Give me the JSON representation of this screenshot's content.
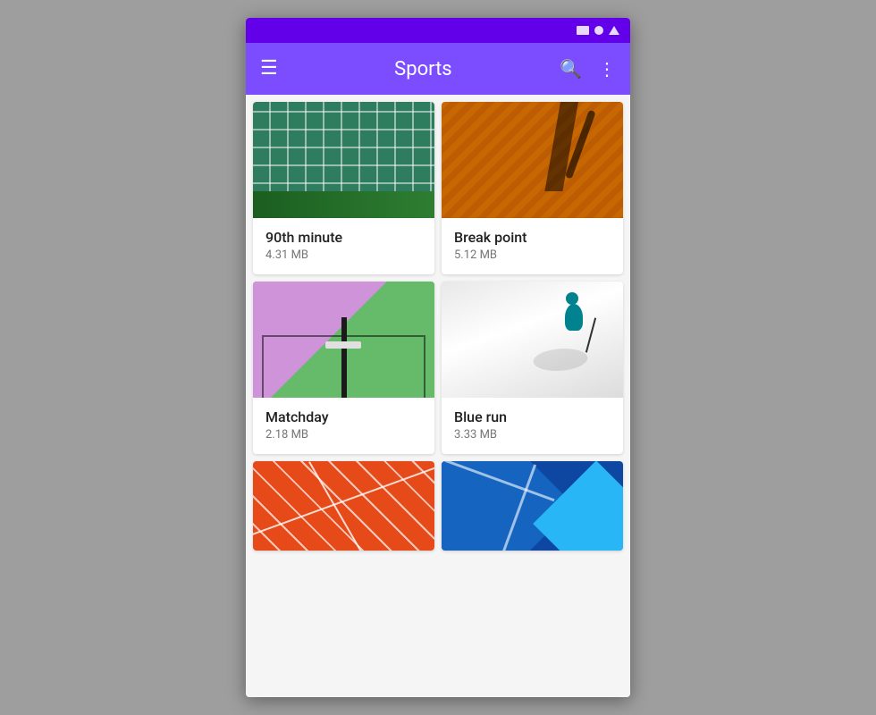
{
  "statusBar": {
    "icons": [
      "rect",
      "circle",
      "triangle"
    ]
  },
  "appBar": {
    "title": "Sports",
    "menuLabel": "Menu",
    "searchLabel": "Search",
    "moreLabel": "More options"
  },
  "cards": [
    {
      "id": "card-90th-minute",
      "title": "90th minute",
      "size": "4.31 MB",
      "imageType": "soccer"
    },
    {
      "id": "card-break-point",
      "title": "Break point",
      "size": "5.12 MB",
      "imageType": "tennis"
    },
    {
      "id": "card-matchday",
      "title": "Matchday",
      "size": "2.18 MB",
      "imageType": "matchday"
    },
    {
      "id": "card-blue-run",
      "title": "Blue run",
      "size": "3.33 MB",
      "imageType": "skiing"
    },
    {
      "id": "card-track",
      "title": "",
      "size": "",
      "imageType": "track"
    },
    {
      "id": "card-geo",
      "title": "",
      "size": "",
      "imageType": "geo"
    }
  ],
  "colors": {
    "appBarBg": "#7c4dff",
    "statusBarBg": "#6200ea",
    "cardBg": "#ffffff"
  }
}
